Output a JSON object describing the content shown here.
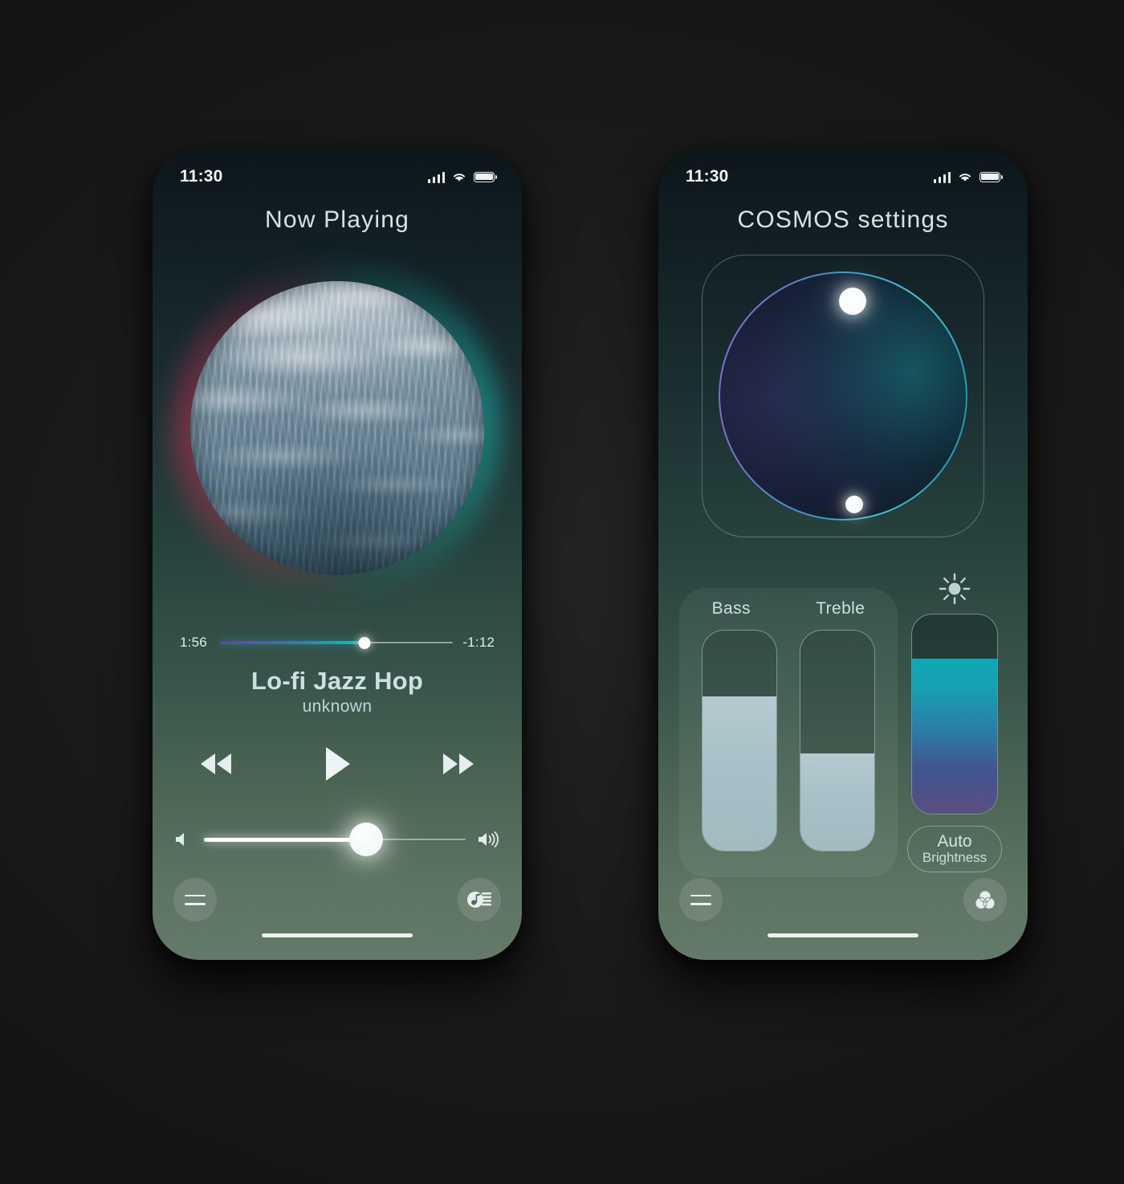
{
  "status_bar": {
    "time": "11:30",
    "signal_icon": "signal-bars-icon",
    "wifi_icon": "wifi-icon",
    "battery_icon": "battery-full-icon"
  },
  "player_screen": {
    "title": "Now Playing",
    "album_art": {
      "icon": "album-art-ocean-circle",
      "glow_left_color": "#d63058",
      "glow_right_color": "#1ac8be"
    },
    "progress": {
      "elapsed": "1:56",
      "remaining": "-1:12",
      "percent": 62,
      "gradient_start": "#6a3fa6",
      "gradient_end": "#12c0c6"
    },
    "track": {
      "title": "Lo-fi Jazz Hop",
      "artist": "unknown"
    },
    "transport": {
      "rewind_label": "Rewind",
      "play_label": "Play",
      "forward_label": "Fast Forward"
    },
    "volume": {
      "percent": 62,
      "low_icon": "speaker-low-icon",
      "high_icon": "speaker-high-icon"
    },
    "bottom_bar": {
      "menu_icon": "hamburger-menu-icon",
      "action_icon": "music-library-icon"
    }
  },
  "settings_screen": {
    "title": "COSMOS settings",
    "orb": {
      "icon": "orbit-control-icon",
      "ring_gradient_start": "#9a6fd8",
      "ring_gradient_end": "#41d3dd",
      "primary_dot": "orb-handle-primary",
      "secondary_dot": "orb-handle-secondary"
    },
    "equalizer": {
      "sliders": [
        {
          "label": "Bass",
          "percent": 70
        },
        {
          "label": "Treble",
          "percent": 44
        }
      ]
    },
    "brightness": {
      "icon": "sun-icon",
      "percent": 78,
      "gradient_top": "#0fa8b5",
      "gradient_bottom": "#5a4f84",
      "auto_line1": "Auto",
      "auto_line2": "Brightness"
    },
    "bottom_bar": {
      "menu_icon": "hamburger-menu-icon",
      "action_icon": "color-theme-icon"
    }
  }
}
